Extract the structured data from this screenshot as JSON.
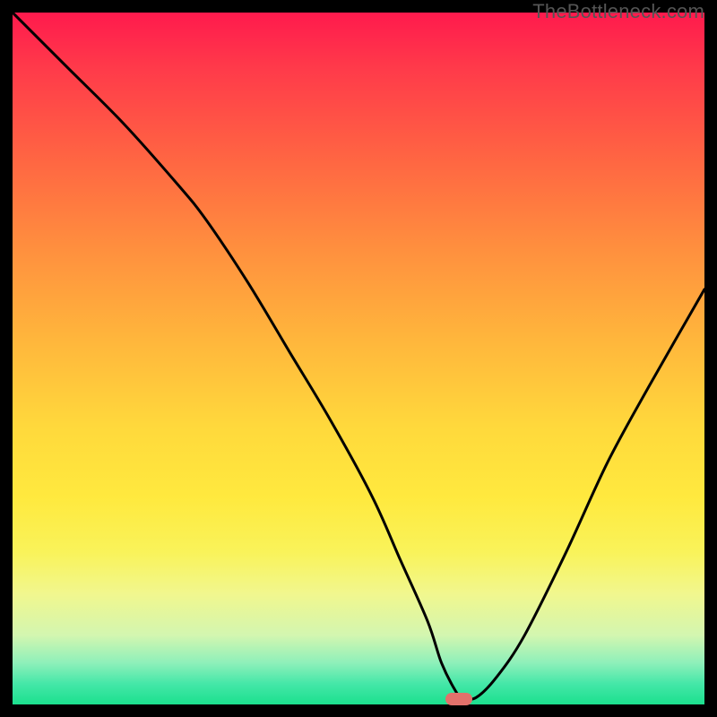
{
  "watermark": "TheBottleneck.com",
  "marker": {
    "x_frac": 0.645,
    "y_frac": 0.992,
    "w": 30,
    "h": 14,
    "color": "#e2716b"
  },
  "chart_data": {
    "type": "line",
    "title": "",
    "xlabel": "",
    "ylabel": "",
    "xlim": [
      0,
      100
    ],
    "ylim": [
      0,
      100
    ],
    "grid": false,
    "legend": false,
    "x": [
      0,
      8,
      16,
      24,
      28,
      34,
      40,
      46,
      52,
      56,
      60,
      62,
      64,
      65,
      67,
      70,
      74,
      80,
      86,
      92,
      100
    ],
    "y": [
      100,
      92,
      84,
      75,
      70,
      61,
      51,
      41,
      30,
      21,
      12,
      6,
      2,
      1,
      1,
      4,
      10,
      22,
      35,
      46,
      60
    ],
    "annotations": []
  }
}
